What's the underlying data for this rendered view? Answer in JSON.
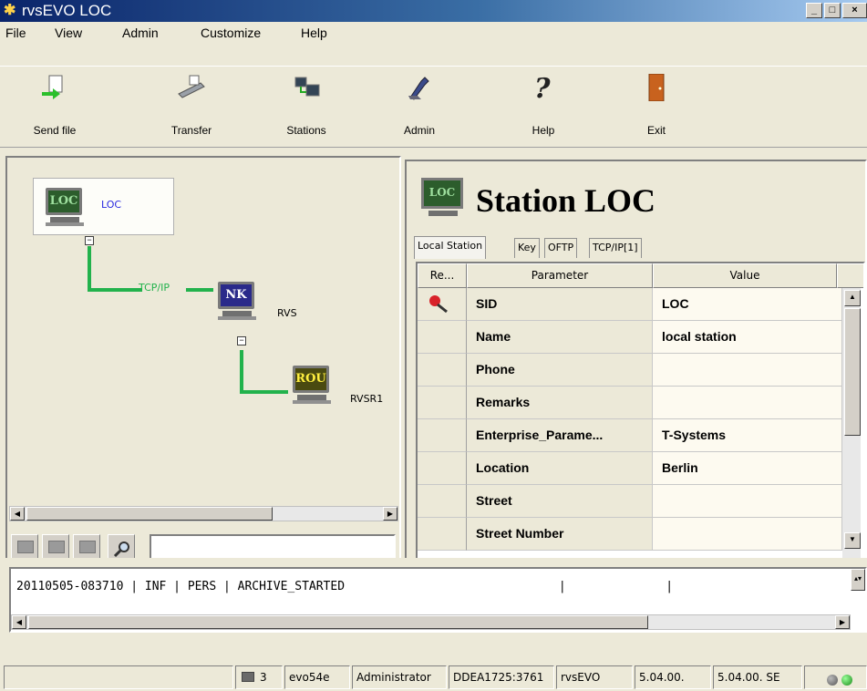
{
  "window": {
    "title": "rvsEVO LOC",
    "controls": {
      "minimize": "_",
      "maximize": "□",
      "close": "×"
    }
  },
  "menu": [
    "File",
    "View",
    "Admin",
    "Customize",
    "Help"
  ],
  "toolbar": [
    {
      "label": "Send file",
      "icon": "send-file-icon"
    },
    {
      "label": "Transfer",
      "icon": "transfer-icon"
    },
    {
      "label": "Stations",
      "icon": "stations-icon"
    },
    {
      "label": "Admin",
      "icon": "admin-icon"
    },
    {
      "label": "Help",
      "icon": "help-icon"
    },
    {
      "label": "Exit",
      "icon": "exit-icon"
    }
  ],
  "topology": {
    "root": {
      "screen": "LOC",
      "label": "LOC"
    },
    "link_label": "TCP/IP",
    "child": {
      "screen": "NK",
      "label": "RVS"
    },
    "grandchild": {
      "screen": "ROU",
      "label": "RVSR1"
    }
  },
  "station": {
    "title": "Station LOC",
    "screen": "LOC",
    "tabs": [
      "Local Station",
      "Key",
      "OFTP",
      "TCP/IP[1]"
    ],
    "active_tab": 0,
    "columns": [
      "Re...",
      "Parameter",
      "Value"
    ],
    "rows": [
      {
        "parameter": "SID",
        "value": "LOC",
        "required": true
      },
      {
        "parameter": "Name",
        "value": "local station"
      },
      {
        "parameter": "Phone",
        "value": ""
      },
      {
        "parameter": "Remarks",
        "value": ""
      },
      {
        "parameter": "Enterprise_Parame...",
        "value": "T-Systems"
      },
      {
        "parameter": "Location",
        "value": "Berlin"
      },
      {
        "parameter": "Street",
        "value": ""
      },
      {
        "parameter": "Street Number",
        "value": ""
      }
    ]
  },
  "log": {
    "line": "20110505-083710 | INF | PERS | ARCHIVE_STARTED                              |              |"
  },
  "statusbar": {
    "connections": "3",
    "host": "evo54e",
    "user": "Administrator",
    "address": "DDEA1725:3761",
    "product": "rvsEVO",
    "version1": "5.04.00.",
    "version2": "5.04.00. SE"
  },
  "colors": {
    "link": "#22b24c",
    "loc_screen": "#2c5d2c",
    "nk_screen": "#2a2a8a",
    "rou_screen": "#4a4a10"
  }
}
